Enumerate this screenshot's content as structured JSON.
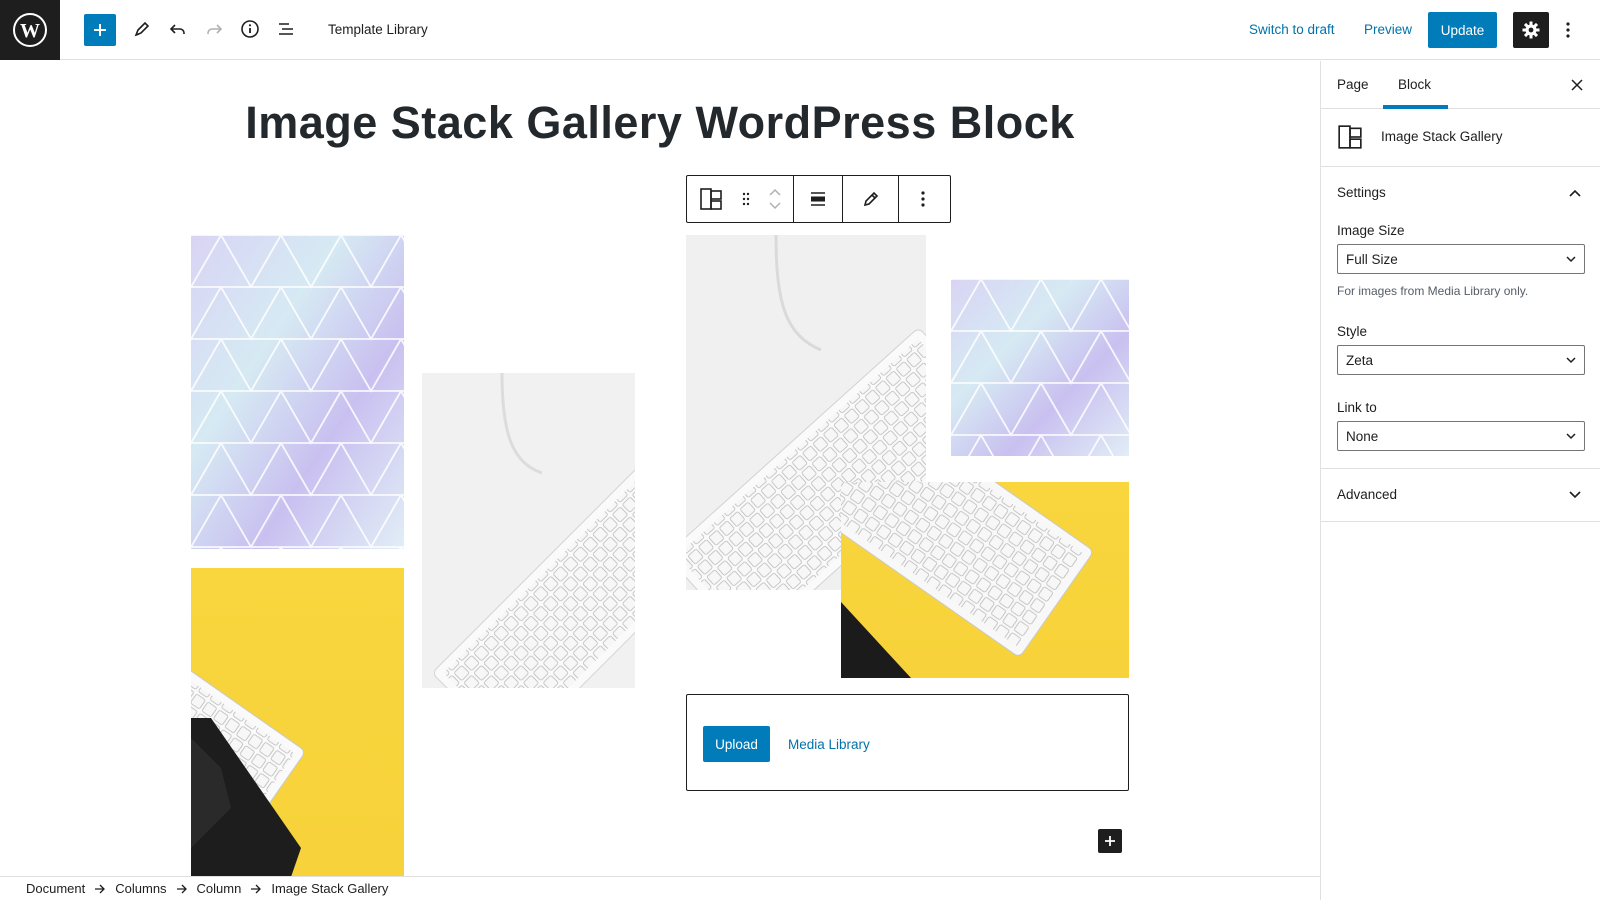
{
  "topbar": {
    "logo_icon": "wordpress-logo-icon",
    "document_title": "Template Library",
    "switch_to_draft": "Switch to draft",
    "preview": "Preview",
    "update": "Update",
    "accent": "#007cba"
  },
  "canvas": {
    "page_title": "Image Stack Gallery WordPress Block",
    "upload_label": "Upload",
    "media_library_label": "Media Library"
  },
  "breadcrumb": [
    "Document",
    "Columns",
    "Column",
    "Image Stack Gallery"
  ],
  "sidebar": {
    "tabs": [
      "Page",
      "Block"
    ],
    "active_tab": "Block",
    "block_name": "Image Stack Gallery",
    "settings_title": "Settings",
    "image_size_label": "Image Size",
    "image_size_value": "Full Size",
    "image_size_help": "For images from Media Library only.",
    "style_label": "Style",
    "style_value": "Zeta",
    "link_to_label": "Link to",
    "link_to_value": "None",
    "advanced_title": "Advanced"
  }
}
